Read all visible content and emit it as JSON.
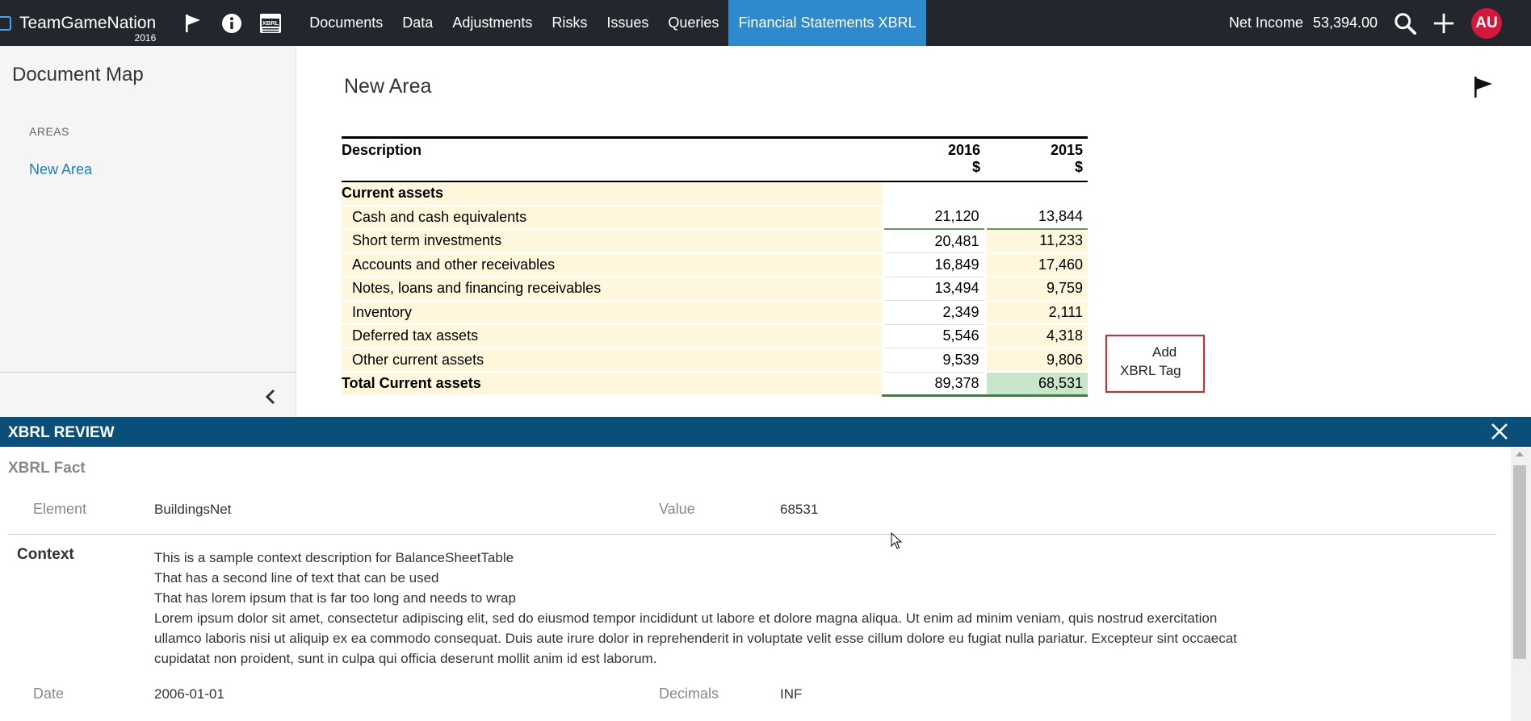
{
  "navbar": {
    "brand": "TeamGameNation",
    "year": "2016",
    "icons": [
      "flag-icon",
      "info-icon",
      "xbrl-icon"
    ],
    "menu": [
      {
        "label": "Documents",
        "active": false
      },
      {
        "label": "Data",
        "active": false
      },
      {
        "label": "Adjustments",
        "active": false
      },
      {
        "label": "Risks",
        "active": false
      },
      {
        "label": "Issues",
        "active": false
      },
      {
        "label": "Queries",
        "active": false
      },
      {
        "label": "Financial Statements XBRL",
        "active": true
      }
    ],
    "net_income_label": "Net Income",
    "net_income_value": "53,394.00",
    "avatar": "AU",
    "colors": {
      "bar": "#23272d",
      "active": "#2f89cd",
      "avatar": "#d5173a"
    }
  },
  "sidebar": {
    "title": "Document Map",
    "section": "AREAS",
    "items": [
      "New Area"
    ]
  },
  "main": {
    "area_title": "New Area",
    "table": {
      "headers": {
        "description": "Description",
        "col1_year": "2016",
        "col1_unit": "$",
        "col2_year": "2015",
        "col2_unit": "$"
      },
      "section_title": "Current assets",
      "rows": [
        {
          "label": "Cash and cash equivalents",
          "v2016": "21,120",
          "v2015": "13,844"
        },
        {
          "label": "Short term investments",
          "v2016": "20,481",
          "v2015": "11,233"
        },
        {
          "label": "Accounts and other receivables",
          "v2016": "16,849",
          "v2015": "17,460"
        },
        {
          "label": "Notes, loans and financing receivables",
          "v2016": "13,494",
          "v2015": "9,759"
        },
        {
          "label": "Inventory",
          "v2016": "2,349",
          "v2015": "2,111"
        },
        {
          "label": "Deferred tax assets",
          "v2016": "5,546",
          "v2015": "4,318"
        },
        {
          "label": "Other current assets",
          "v2016": "9,539",
          "v2015": "9,806"
        }
      ],
      "total": {
        "label": "Total Current assets",
        "v2016": "89,378",
        "v2015": "68,531"
      }
    },
    "add_tag_line1": "Add",
    "add_tag_line2": "XBRL Tag"
  },
  "review": {
    "header": "XBRL REVIEW",
    "subtitle": "XBRL Fact",
    "element_label": "Element",
    "element_value": "BuildingsNet",
    "value_label": "Value",
    "value_value": "68531",
    "context_label": "Context",
    "context_lines": [
      "This is a sample context description for BalanceSheetTable",
      "That has a second line of text that can be used",
      "That has lorem ipsum that is far too long and needs to wrap",
      "Lorem ipsum dolor sit amet, consectetur adipiscing elit, sed do eiusmod tempor incididunt ut labore et dolore magna aliqua. Ut enim ad minim veniam, quis nostrud exercitation ullamco laboris nisi ut aliquip ex ea commodo consequat. Duis aute irure dolor in reprehenderit in voluptate velit esse cillum dolore eu fugiat nulla pariatur. Excepteur sint occaecat cupidatat non proident, sunt in culpa qui officia deserunt mollit anim id est laborum."
    ],
    "date_label": "Date",
    "date_value": "2006-01-01",
    "decimals_label": "Decimals",
    "decimals_value": "INF",
    "header_color": "#0a4f7a"
  }
}
